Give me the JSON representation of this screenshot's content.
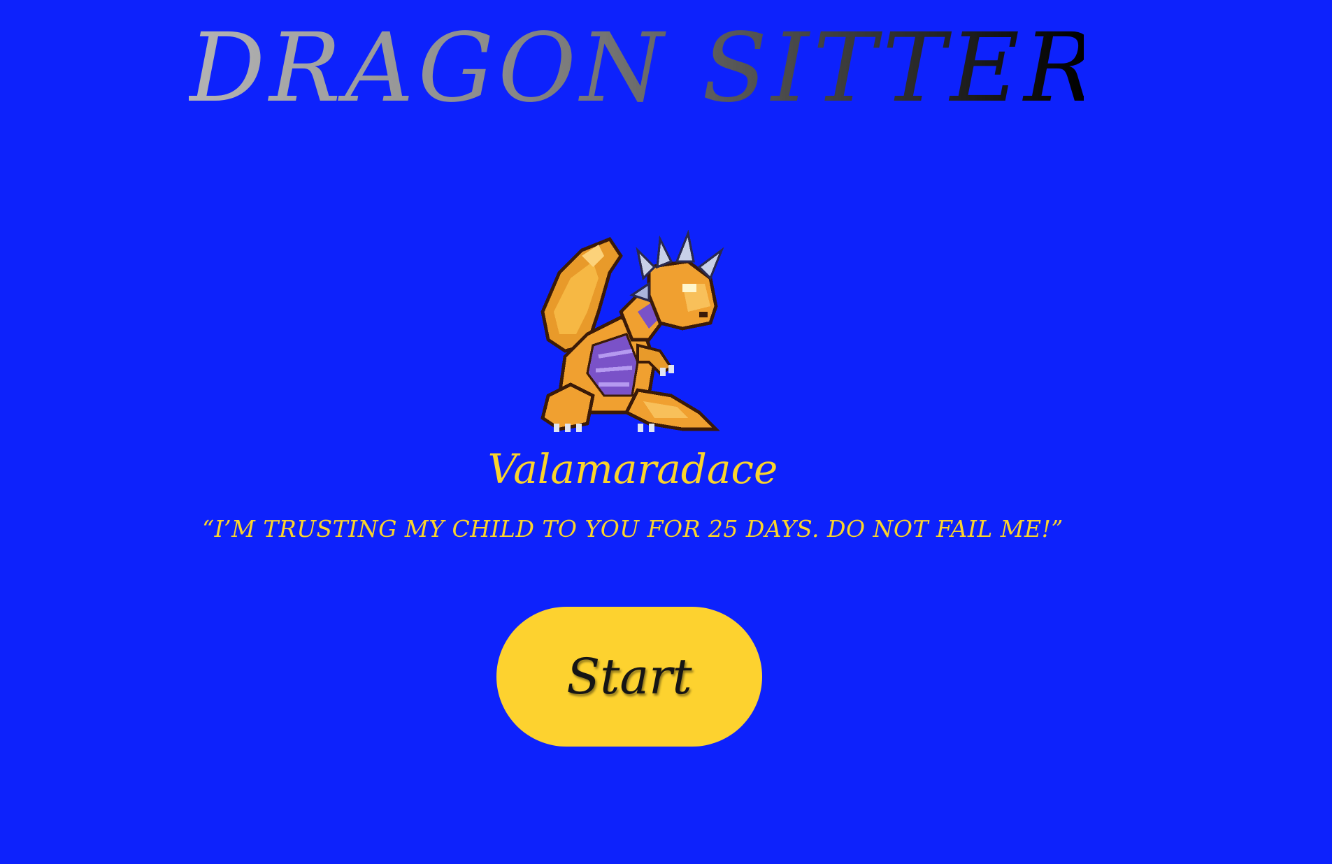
{
  "title": "DRAGON SITTER",
  "dragon": {
    "name": "Valamaradace",
    "quote": "“I’M TRUSTING MY CHILD TO YOU FOR 25 DAYS. DO NOT FAIL ME!”",
    "icon": "orange-dragon-sprite"
  },
  "start_button": {
    "label": "Start"
  },
  "colors": {
    "background": "#0d22fc",
    "text_accent": "#fad42c",
    "button": "#fdd22f"
  }
}
